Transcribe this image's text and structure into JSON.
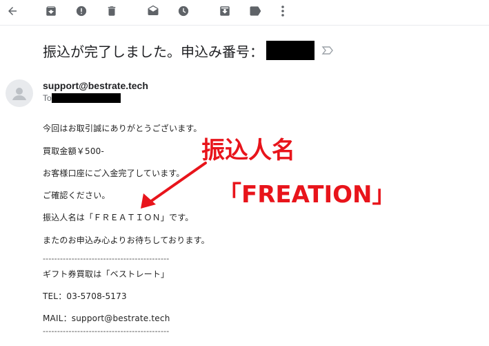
{
  "toolbar": {
    "icons": [
      "back-arrow-icon",
      "archive-icon",
      "report-spam-icon",
      "delete-icon",
      "mark-unread-icon",
      "snooze-icon",
      "move-to-icon",
      "label-icon",
      "more-options-icon"
    ]
  },
  "email": {
    "subject": "振込が完了しました。申込み番号：",
    "sender": "support@bestrate.tech",
    "to_label": "To",
    "body_lines": [
      "今回はお取引誠にありがとうございます。",
      "買取金額￥500-",
      "お客様口座にご入金完了しています。",
      "ご確認ください。",
      "振込人名は「ＦＲＥＡＴＩＯＮ」です。",
      "またのお申込み心よりお待ちしております。",
      "--------------------------------------------",
      "ギフト券買取は「ベストレート」",
      "TEL：03-5708-5173",
      "MAIL：support@bestrate.tech",
      "--------------------------------------------"
    ]
  },
  "annotation": {
    "line1": "振込人名",
    "line2": "「FREATION」",
    "color": "#e8141b"
  }
}
